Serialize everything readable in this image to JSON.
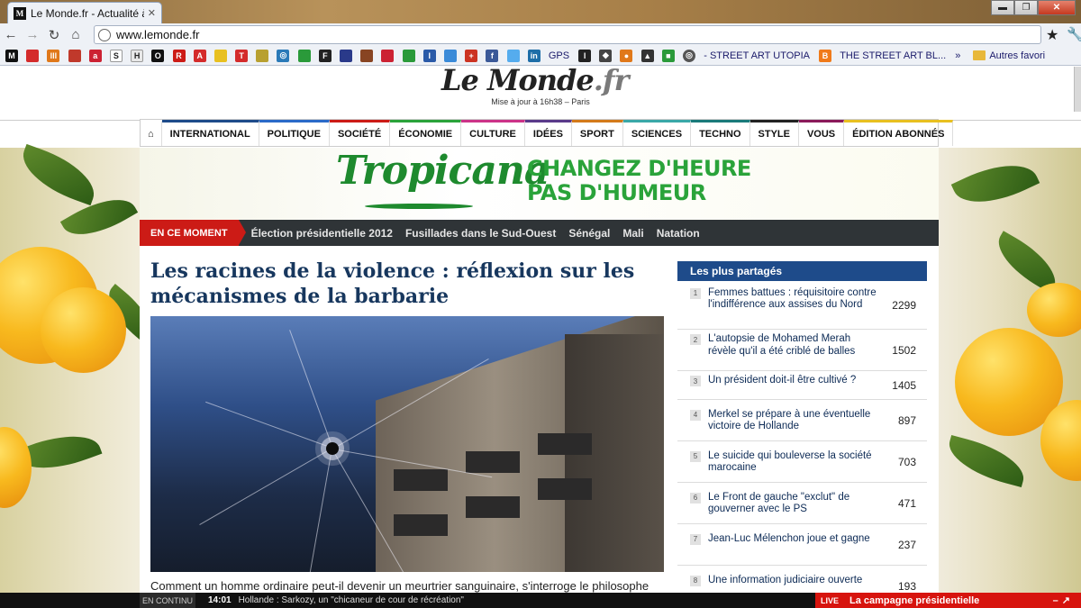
{
  "browser": {
    "tab_title": "Le Monde.fr - Actualité à la",
    "tab_favicon": "M",
    "tab_close": "✕",
    "url": "www.lemonde.fr",
    "window_controls": [
      "▬",
      "❐",
      "✕"
    ],
    "bookmark_icons": [
      {
        "label": "M",
        "color": "#111111"
      },
      {
        "label": "",
        "color": "#d42b2b"
      },
      {
        "label": "lll",
        "color": "#e0781a"
      },
      {
        "label": "",
        "color": "#c0392b"
      },
      {
        "label": "a",
        "color": "#cc2233"
      },
      {
        "label": "S",
        "color": "#ffffff"
      },
      {
        "label": "H",
        "color": "#e8e8e8"
      },
      {
        "label": "O",
        "color": "#111111"
      },
      {
        "label": "R",
        "color": "#cc1b16"
      },
      {
        "label": "A",
        "color": "#d42b2b"
      },
      {
        "label": "",
        "color": "#e8c020"
      },
      {
        "label": "T",
        "color": "#d42b2b"
      },
      {
        "label": "",
        "color": "#b8a030"
      },
      {
        "label": "◎",
        "color": "#2a7ab8"
      },
      {
        "label": "",
        "color": "#2a9a3a"
      },
      {
        "label": "F",
        "color": "#222222"
      },
      {
        "label": "",
        "color": "#2a3a8a"
      },
      {
        "label": "",
        "color": "#884422"
      },
      {
        "label": "",
        "color": "#cc2233"
      },
      {
        "label": "",
        "color": "#2a9a3a"
      },
      {
        "label": "I",
        "color": "#2a5aa8"
      },
      {
        "label": "",
        "color": "#3a8ad8"
      },
      {
        "label": "+",
        "color": "#cc3322"
      },
      {
        "label": "f",
        "color": "#3b5998"
      },
      {
        "label": "",
        "color": "#55acee"
      },
      {
        "label": "in",
        "color": "#1e6ea8"
      }
    ],
    "bookmark_gps": "GPS",
    "bookmark_street_art_utopia": "- STREET ART UTOPIA",
    "bookmark_street_art_blog": "THE STREET ART BL...",
    "bookmark_more": "»",
    "bookmark_folder": "Autres favori"
  },
  "masthead": {
    "logo_main": "Le Monde",
    "logo_suffix": ".fr",
    "update_text": "Mise à jour à 16h38 – Paris"
  },
  "nav": {
    "home_icon": "⌂",
    "items": [
      {
        "label": "INTERNATIONAL",
        "color": "#1e4b8a"
      },
      {
        "label": "POLITIQUE",
        "color": "#2a6ac8"
      },
      {
        "label": "SOCIÉTÉ",
        "color": "#cc1b16"
      },
      {
        "label": "ÉCONOMIE",
        "color": "#2aa33a"
      },
      {
        "label": "CULTURE",
        "color": "#cc3388"
      },
      {
        "label": "IDÉES",
        "color": "#5a3a8a"
      },
      {
        "label": "SPORT",
        "color": "#d47a1a"
      },
      {
        "label": "SCIENCES",
        "color": "#3aa8a8"
      },
      {
        "label": "TECHNO",
        "color": "#1a7a7a"
      },
      {
        "label": "STYLE",
        "color": "#222222"
      },
      {
        "label": "VOUS",
        "color": "#8a1a5a"
      },
      {
        "label": "ÉDITION ABONNÉS",
        "color": "#e8c020"
      }
    ]
  },
  "ad": {
    "brand": "Tropicana",
    "slogan_line1": "CHANGEZ D'HEURE",
    "slogan_line2": "PAS D'HUMEUR"
  },
  "trending": {
    "label": "EN CE MOMENT",
    "items": [
      "Élection présidentielle 2012",
      "Fusillades dans le Sud-Ouest",
      "Sénégal",
      "Mali",
      "Natation"
    ]
  },
  "article": {
    "headline": "Les racines de la violence : réflexion sur les mécanismes de la barbarie",
    "lead": "Comment un homme ordinaire peut-il devenir un meurtrier sanguinaire, s'interroge le philosophe"
  },
  "sidebar": {
    "title": "Les plus partagés",
    "items": [
      {
        "rank": "1",
        "text": "Femmes battues : réquisitoire contre l'indifférence aux assises du Nord",
        "count": "2299"
      },
      {
        "rank": "2",
        "text": "L'autopsie de Mohamed Merah révèle qu'il a été criblé de balles",
        "count": "1502"
      },
      {
        "rank": "3",
        "text": "Un président doit-il être cultivé ?",
        "count": "1405"
      },
      {
        "rank": "4",
        "text": "Merkel se prépare à une éventuelle victoire de Hollande",
        "count": "897"
      },
      {
        "rank": "5",
        "text": "Le suicide qui bouleverse la société marocaine",
        "count": "703"
      },
      {
        "rank": "6",
        "text": "Le Front de gauche \"exclut\" de gouverner avec le PS",
        "count": "471"
      },
      {
        "rank": "7",
        "text": "Jean-Luc Mélenchon joue et gagne",
        "count": "237"
      },
      {
        "rank": "8",
        "text": "Une information judiciaire ouverte",
        "count": "193"
      }
    ]
  },
  "ticker": {
    "label": "EN CONTINU",
    "time": "14:01",
    "text": "Hollande : Sarkozy, un \"chicaneur de cour de récréation\"",
    "live_tag": "LIVE",
    "live_text": "La campagne présidentielle",
    "live_controls": "–↗"
  }
}
